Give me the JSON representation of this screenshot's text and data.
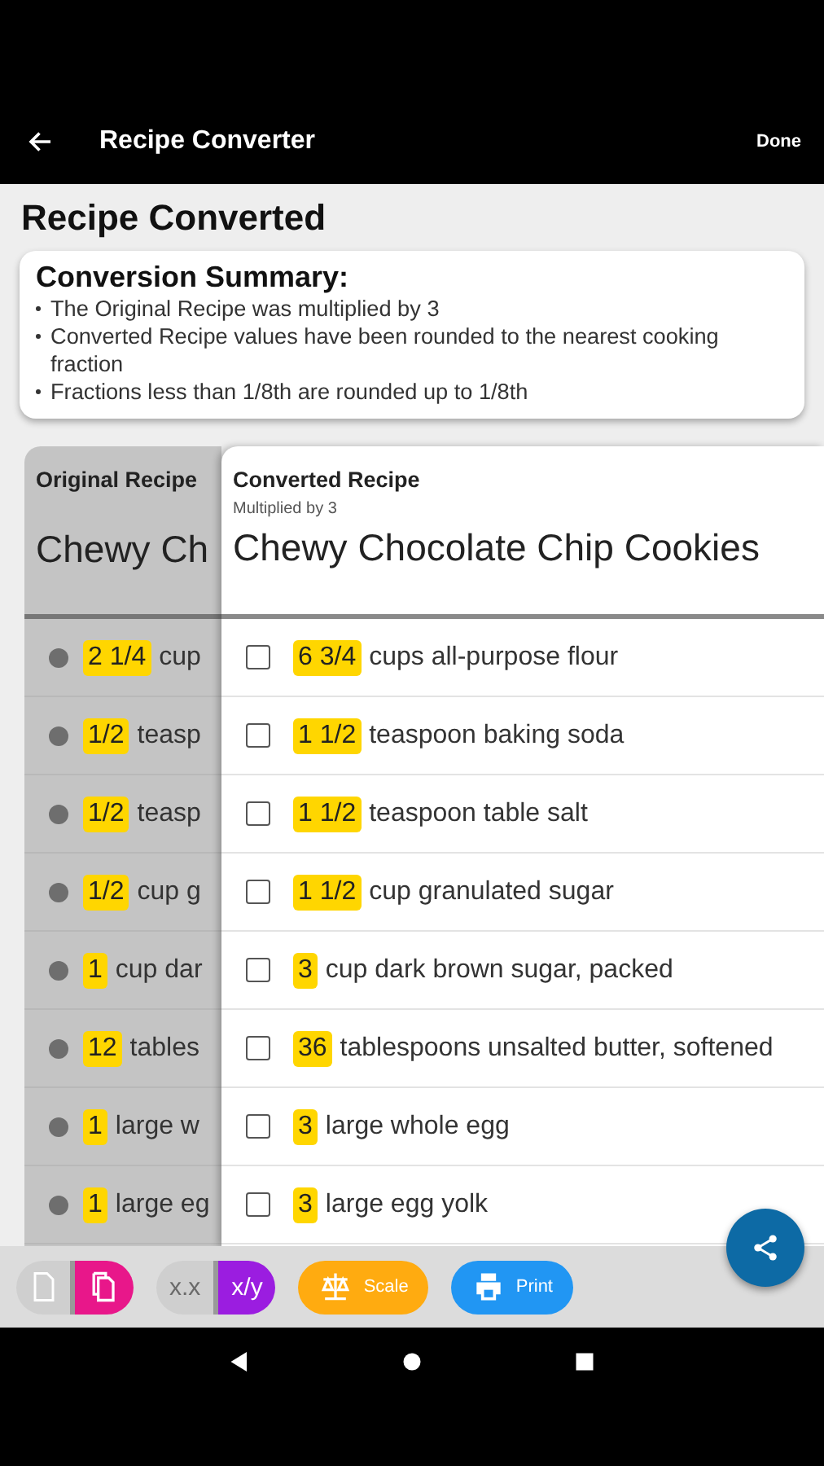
{
  "app_bar": {
    "title": "Recipe Converter",
    "action": "Done"
  },
  "heading": "Recipe Converted",
  "summary": {
    "title": "Conversion Summary:",
    "bullets": [
      "The Original Recipe was multiplied by 3",
      "Converted Recipe values have been rounded to the nearest cooking fraction",
      "Fractions less than 1/8th are rounded up to 1/8th"
    ]
  },
  "original": {
    "label": "Original Recipe",
    "name": "Chewy Ch",
    "rows": [
      {
        "qty": "2 1/4",
        "text": "cup"
      },
      {
        "qty": "1/2",
        "text": "teasp"
      },
      {
        "qty": "1/2",
        "text": "teasp"
      },
      {
        "qty": "1/2",
        "text": "cup g"
      },
      {
        "qty": "1",
        "text": "cup dar"
      },
      {
        "qty": "12",
        "text": "tables"
      },
      {
        "qty": "1",
        "text": "large w"
      },
      {
        "qty": "1",
        "text": "large eg"
      }
    ]
  },
  "converted": {
    "label": "Converted Recipe",
    "subtitle": "Multiplied by 3",
    "name": "Chewy Chocolate Chip Cookies",
    "rows": [
      {
        "qty": "6 3/4",
        "text": "cups all-purpose flour",
        "checked": false
      },
      {
        "qty": "1 1/2",
        "text": "teaspoon baking soda",
        "checked": false
      },
      {
        "qty": "1 1/2",
        "text": "teaspoon table salt",
        "checked": false
      },
      {
        "qty": "1 1/2",
        "text": "cup granulated sugar",
        "checked": false
      },
      {
        "qty": "3",
        "text": "cup dark brown sugar, packed",
        "checked": false
      },
      {
        "qty": "36",
        "text": "tablespoons unsalted butter, softened",
        "checked": false
      },
      {
        "qty": "3",
        "text": "large whole egg",
        "checked": false
      },
      {
        "qty": "3",
        "text": "large egg yolk",
        "checked": false
      }
    ]
  },
  "toolbar": {
    "format_toggle": [
      {
        "kind": "single",
        "selected": false
      },
      {
        "kind": "copy",
        "selected": true
      }
    ],
    "number_toggle": [
      {
        "label": "x.x",
        "selected": false
      },
      {
        "label": "x/y",
        "selected": true
      }
    ],
    "buttons": [
      {
        "kind": "scale",
        "label": "Scale"
      },
      {
        "kind": "print",
        "label": "Print"
      }
    ]
  }
}
